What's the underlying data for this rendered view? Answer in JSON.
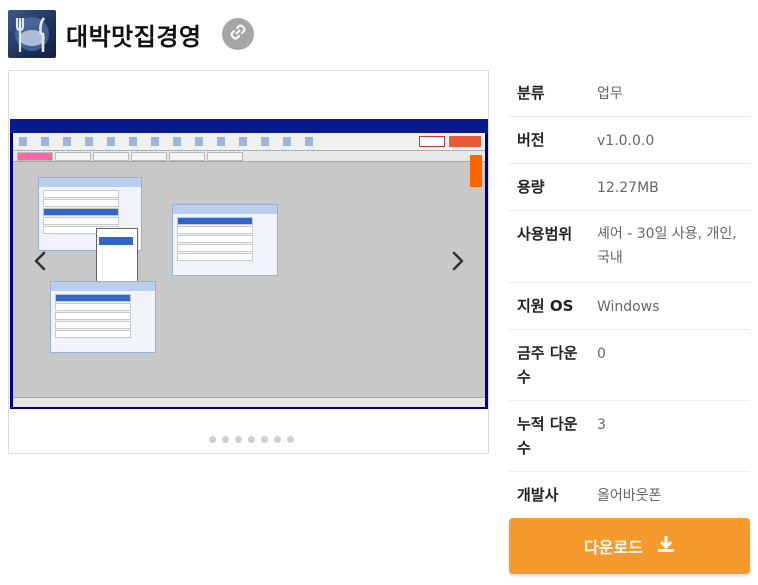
{
  "header": {
    "title": "대박맛집경영",
    "icon": "restaurant-utensils-icon",
    "link_icon": "link-icon"
  },
  "gallery": {
    "prev_icon": "chevron-left-icon",
    "next_icon": "chevron-right-icon",
    "dot_count": 7
  },
  "info": [
    {
      "label": "분류",
      "value": "업무"
    },
    {
      "label": "버전",
      "value": "v1.0.0.0"
    },
    {
      "label": "용량",
      "value": "12.27MB"
    },
    {
      "label": "사용범위",
      "value": "셰어 - 30일 사용, 개인, 국내"
    },
    {
      "label": "지원 OS",
      "value": "Windows"
    },
    {
      "label": "금주 다운수",
      "value": "0"
    },
    {
      "label": "누적 다운수",
      "value": "3"
    },
    {
      "label": "개발사",
      "value": "올어바웃폰"
    }
  ],
  "download": {
    "label": "다운로드",
    "icon": "download-icon",
    "color": "#f79a2e"
  }
}
